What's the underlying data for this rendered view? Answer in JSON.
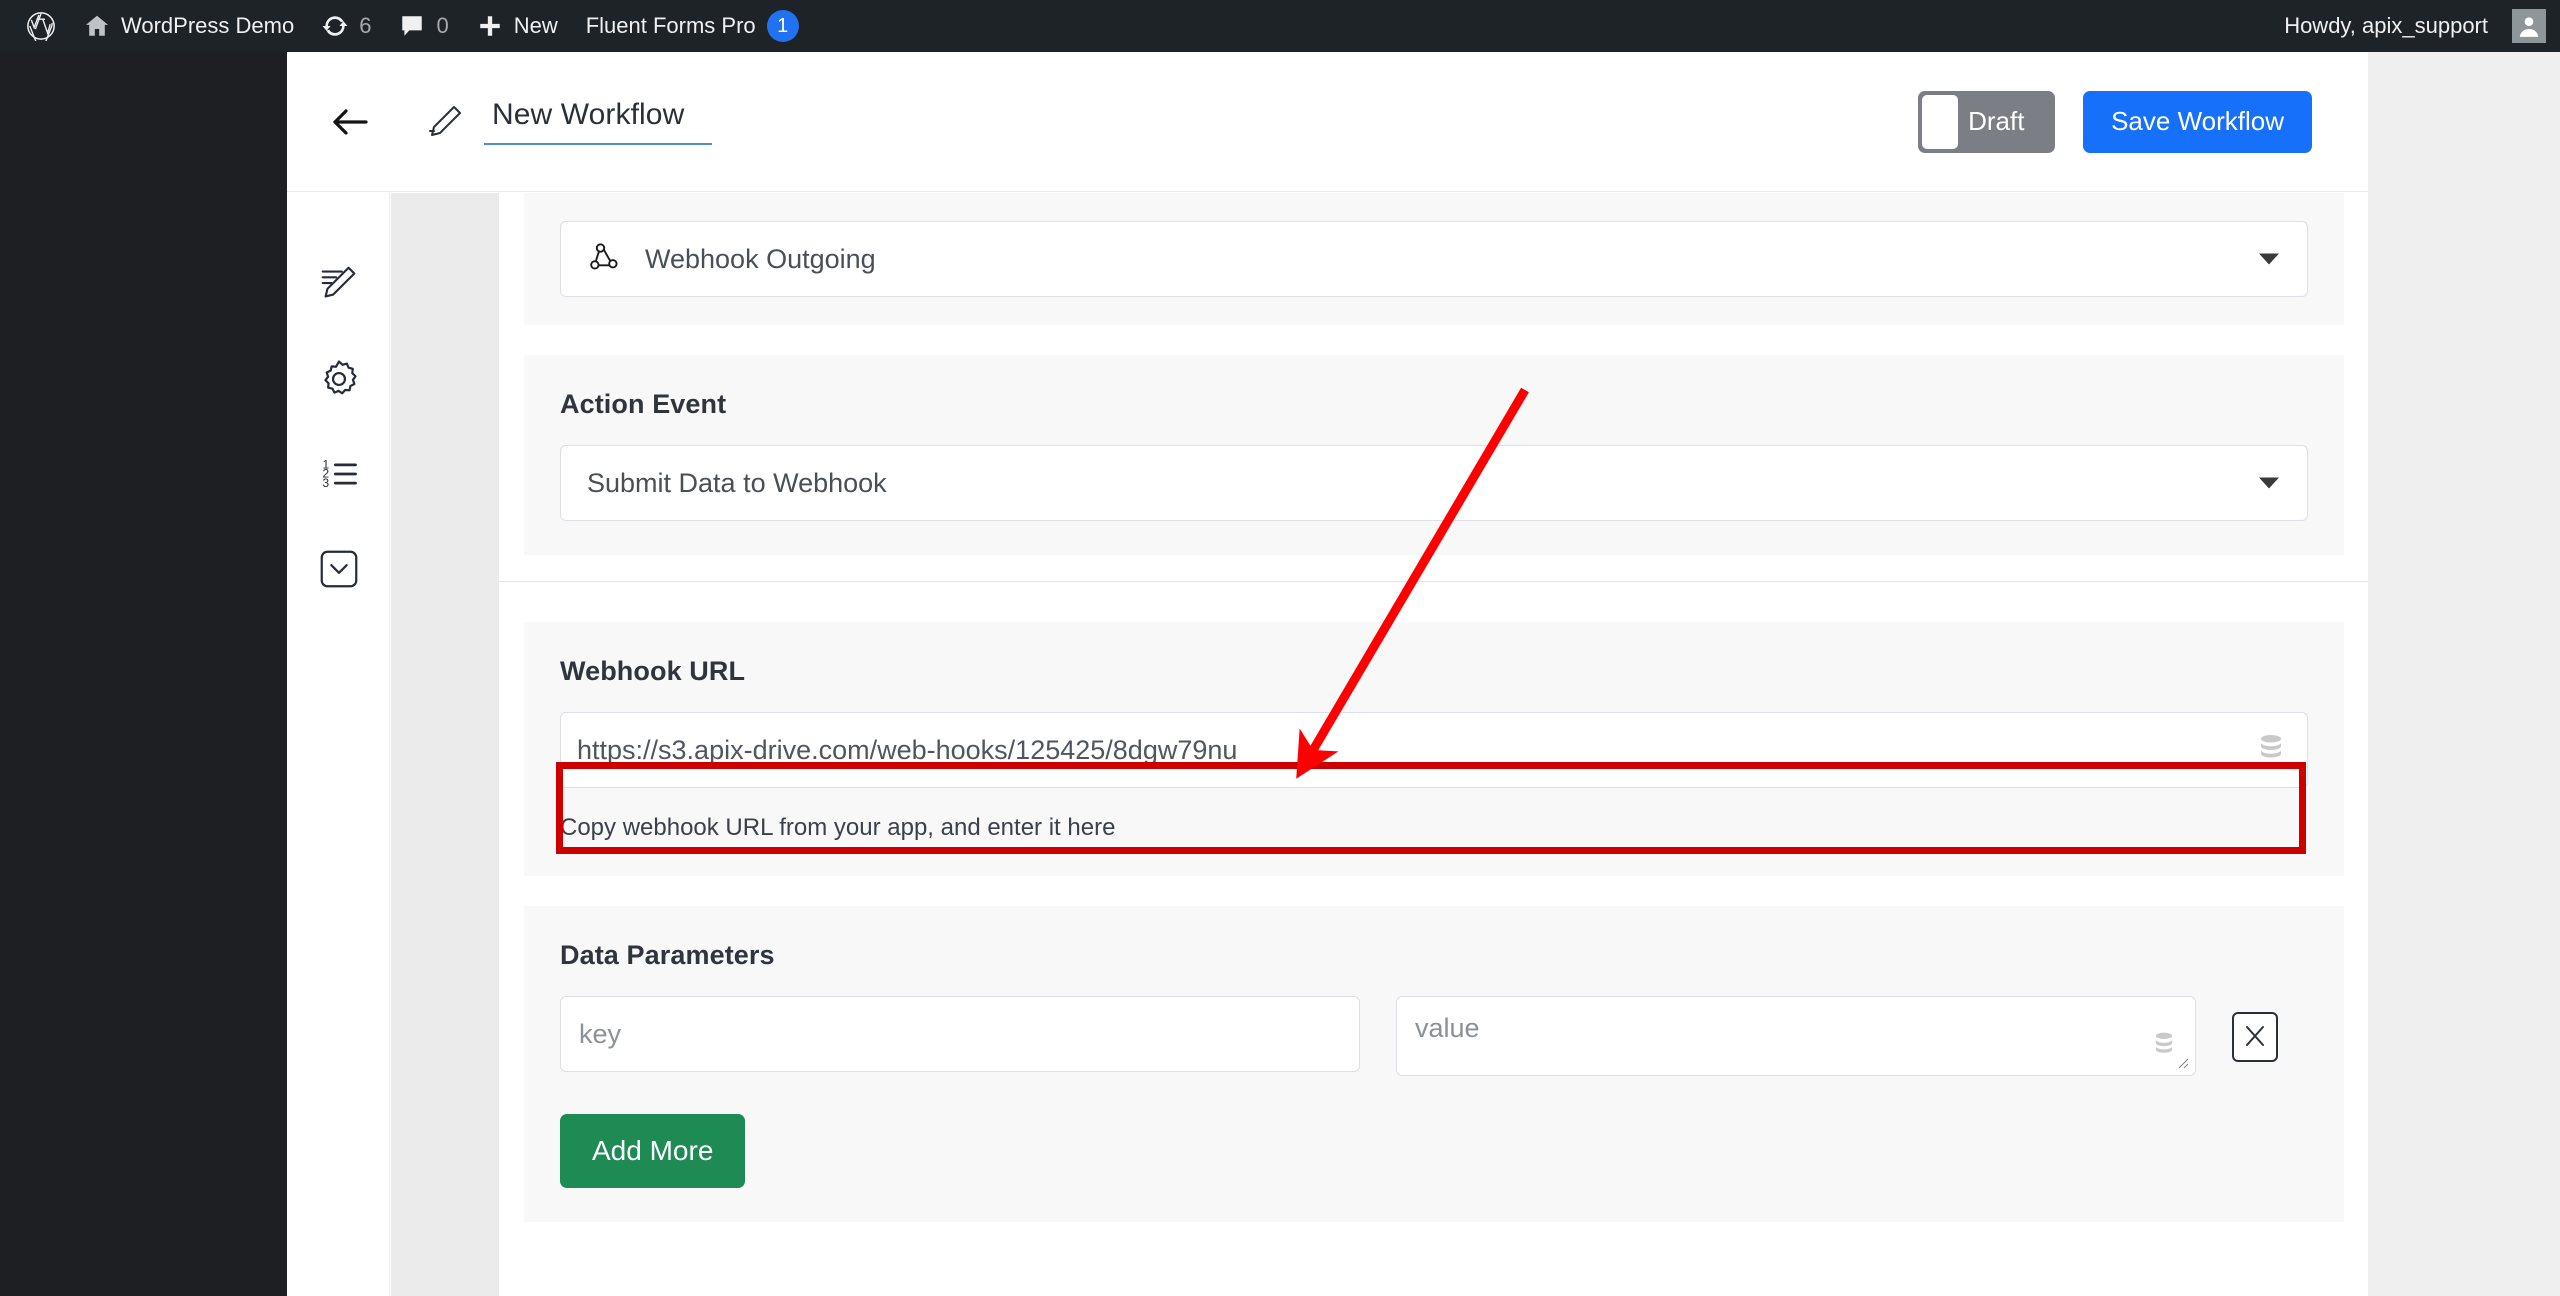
{
  "admin_bar": {
    "site_icon": "wordpress-logo-icon",
    "home_icon": "home-icon",
    "site_name": "WordPress Demo",
    "updates_icon": "updates-icon",
    "updates_count": "6",
    "comments_icon": "comments-icon",
    "comments_count": "0",
    "new_icon": "plus-icon",
    "new_label": "New",
    "plugin_label": "Fluent Forms Pro",
    "plugin_badge": "1",
    "howdy": "Howdy, apix_support",
    "avatar_icon": "user-avatar-icon"
  },
  "workflow_header": {
    "back_icon": "arrow-left-icon",
    "edit_icon": "pencil-edit-icon",
    "title": "New Workflow",
    "status_toggle_label": "Draft",
    "save_label": "Save Workflow",
    "save_color": "#1770fa",
    "toggle_color": "#7b7f85"
  },
  "sidebar": {
    "items": [
      {
        "icon": "edit-note-icon",
        "name": "sidebar-item-edit"
      },
      {
        "icon": "gear-icon",
        "name": "sidebar-item-settings"
      },
      {
        "icon": "numbered-list-icon",
        "name": "sidebar-item-steps"
      },
      {
        "icon": "chevron-down-box-icon",
        "name": "sidebar-item-collapse"
      }
    ]
  },
  "main": {
    "app_select": {
      "icon": "webhook-icon",
      "value": "Webhook Outgoing"
    },
    "action_event": {
      "label": "Action Event",
      "value": "Submit Data to Webhook"
    },
    "webhook_url": {
      "label": "Webhook URL",
      "value": "https://s3.apix-drive.com/web-hooks/125425/8dgw79nu",
      "placeholder": "https://",
      "field_icon": "database-icon",
      "help": "Copy webhook URL from your app, and enter it here",
      "highlight_color": "#cc0000"
    },
    "data_parameters": {
      "label": "Data Parameters",
      "rows": [
        {
          "key_value": "",
          "key_placeholder": "key",
          "value_value": "",
          "value_placeholder": "value",
          "value_icon": "database-icon",
          "remove_icon": "close-x-icon"
        }
      ],
      "add_more_label": "Add More",
      "add_more_color": "#1e8a54"
    }
  },
  "annotation": {
    "arrow_color": "#ff0000",
    "name": "callout-arrow"
  }
}
